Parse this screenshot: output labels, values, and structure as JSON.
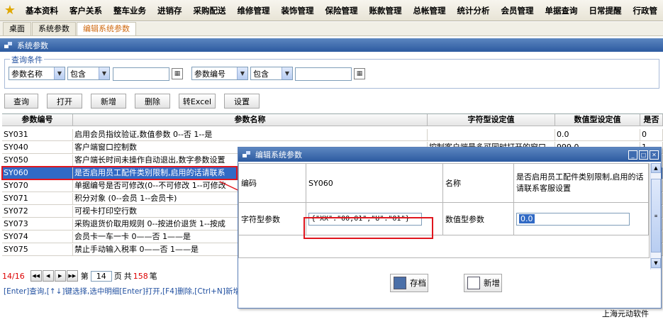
{
  "menu": {
    "items": [
      "基本资料",
      "客户关系",
      "整车业务",
      "进销存",
      "采购配送",
      "维修管理",
      "装饰管理",
      "保险管理",
      "账款管理",
      "总帐管理",
      "统计分析",
      "会员管理",
      "单据查询",
      "日常提醒",
      "行政管"
    ]
  },
  "tabs": [
    "桌面",
    "系统参数",
    "编辑系统参数"
  ],
  "panel": {
    "title": "系统参数"
  },
  "query": {
    "legend": "查询条件",
    "field1": "参数名称",
    "op1": "包含",
    "field2": "参数编号",
    "op2": "包含",
    "cal_icon": "calendar-icon"
  },
  "toolbar": {
    "query": "查询",
    "open": "打开",
    "add": "新增",
    "delete": "删除",
    "excel": "转Excel",
    "settings": "设置"
  },
  "table": {
    "headers": [
      "参数编号",
      "参数名称",
      "字符型设定值",
      "数值型设定值",
      "是否"
    ],
    "rows": [
      [
        "SY031",
        "启用会员指纹验证,数值参数 0--否 1--是",
        "",
        "0.0",
        "0"
      ],
      [
        "SY040",
        "客户端窗口控制数",
        "控制客户端最多可同时打开的窗口",
        "999.0",
        "1"
      ],
      [
        "SY050",
        "客户端长时间未操作自动退出,数字参数设置",
        "",
        "",
        ""
      ],
      [
        "SY060",
        "是否启用员工配件类别限制,启用的话请联系",
        "",
        "",
        ""
      ],
      [
        "SY070",
        "单据编号是否可修改(0--不可修改 1--可修改",
        "",
        "",
        ""
      ],
      [
        "SY071",
        "积分对象 (0--会员 1--会员卡)",
        "",
        "",
        ""
      ],
      [
        "SY072",
        "可视卡打印空行数",
        "",
        "",
        ""
      ],
      [
        "SY073",
        "采购退货价取用规则 0--按进价退货 1--按成",
        "",
        "",
        ""
      ],
      [
        "SY074",
        "会员卡一车一卡 0——否 1——是",
        "",
        "",
        ""
      ],
      [
        "SY075",
        "禁止手动输入税率 0——否 1——是",
        "",
        "",
        ""
      ]
    ]
  },
  "pager": {
    "current": "14/16",
    "page_prefix": "第",
    "page": "14",
    "page_suffix": "页",
    "total_prefix": "共",
    "total": "158",
    "total_suffix": "笔"
  },
  "hint": "[Enter]查询,[↑↓]键选择,选中明细[Enter]打开,[F4]删除,[Ctrl+N]新增",
  "company": "上海元动软件",
  "dialog": {
    "title": "编辑系统参数",
    "code_label": "编码",
    "code_value": "SY060",
    "name_label": "名称",
    "name_value": "是否启用员工配件类别限制,启用的话请联系客服设置",
    "string_label": "字符型参数",
    "string_value": "{\"XX\":\"00,01\",\"U\":\"01\"}",
    "numeric_label": "数值型参数",
    "numeric_value": "0.0",
    "save": "存档",
    "new": "新增"
  },
  "colors": {
    "accent": "#316ac5",
    "header": "#2c5aa0",
    "highlight": "#e0161e",
    "tab_active": "#d06a10"
  }
}
